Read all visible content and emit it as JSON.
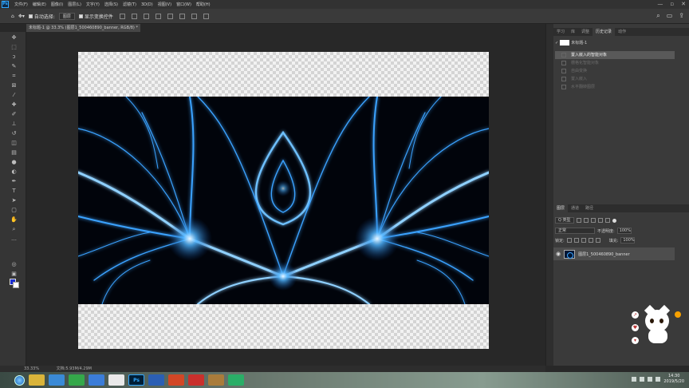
{
  "app": {
    "logo": "Ps",
    "menu": [
      "文件(F)",
      "编辑(E)",
      "图像(I)",
      "图层(L)",
      "文字(Y)",
      "选择(S)",
      "滤镜(T)",
      "3D(D)",
      "视图(V)",
      "窗口(W)",
      "帮助(H)"
    ],
    "window_controls": [
      "—",
      "▫",
      "✕"
    ]
  },
  "options": {
    "auto_select_label": "自动选择:",
    "auto_select_value": "图层",
    "show_transform_label": "显示变换控件",
    "right_icons": [
      "search-icon",
      "workspace-icon",
      "share-icon"
    ]
  },
  "document": {
    "tab_title": "未标题-1 @ 33.3% (图层1_500460890_banner, RGB/8) *"
  },
  "status": {
    "zoom": "33.33%",
    "doc_info": "文档:5.93M/4.29M"
  },
  "history_panel": {
    "tabs": [
      "学习",
      "库",
      "调整",
      "历史记录",
      "动作"
    ],
    "active_tab": "历史记录",
    "snapshot_label": "未标题-1",
    "items": [
      {
        "label": "置入嵌入的智能对象",
        "active": true
      },
      {
        "label": "栅格化智能对象",
        "active": false
      },
      {
        "label": "自由变换",
        "active": false
      },
      {
        "label": "置入嵌入",
        "active": false
      },
      {
        "label": "水平翻转图层",
        "active": false
      }
    ]
  },
  "layers_panel": {
    "tabs": [
      "图层",
      "通道",
      "路径"
    ],
    "active_tab": "图层",
    "filter_kind": "Q 类型",
    "blend_mode": "正常",
    "opacity_label": "不透明度:",
    "opacity_value": "100%",
    "lock_label": "锁定:",
    "fill_label": "填充:",
    "fill_value": "100%",
    "layer_name": "图层1_500460890_banner"
  },
  "taskbar": {
    "apps": [
      "chrome",
      "ie",
      "360",
      "wechat-work",
      "qq",
      "ps",
      "word",
      "ppt",
      "wps",
      "gift",
      "wechat"
    ],
    "clock_time": "14:30",
    "clock_date": "2019/5/20"
  },
  "colors": {
    "accent": "#31a8ff",
    "foreground": "#1a2ccf",
    "background": "#ffffff"
  }
}
